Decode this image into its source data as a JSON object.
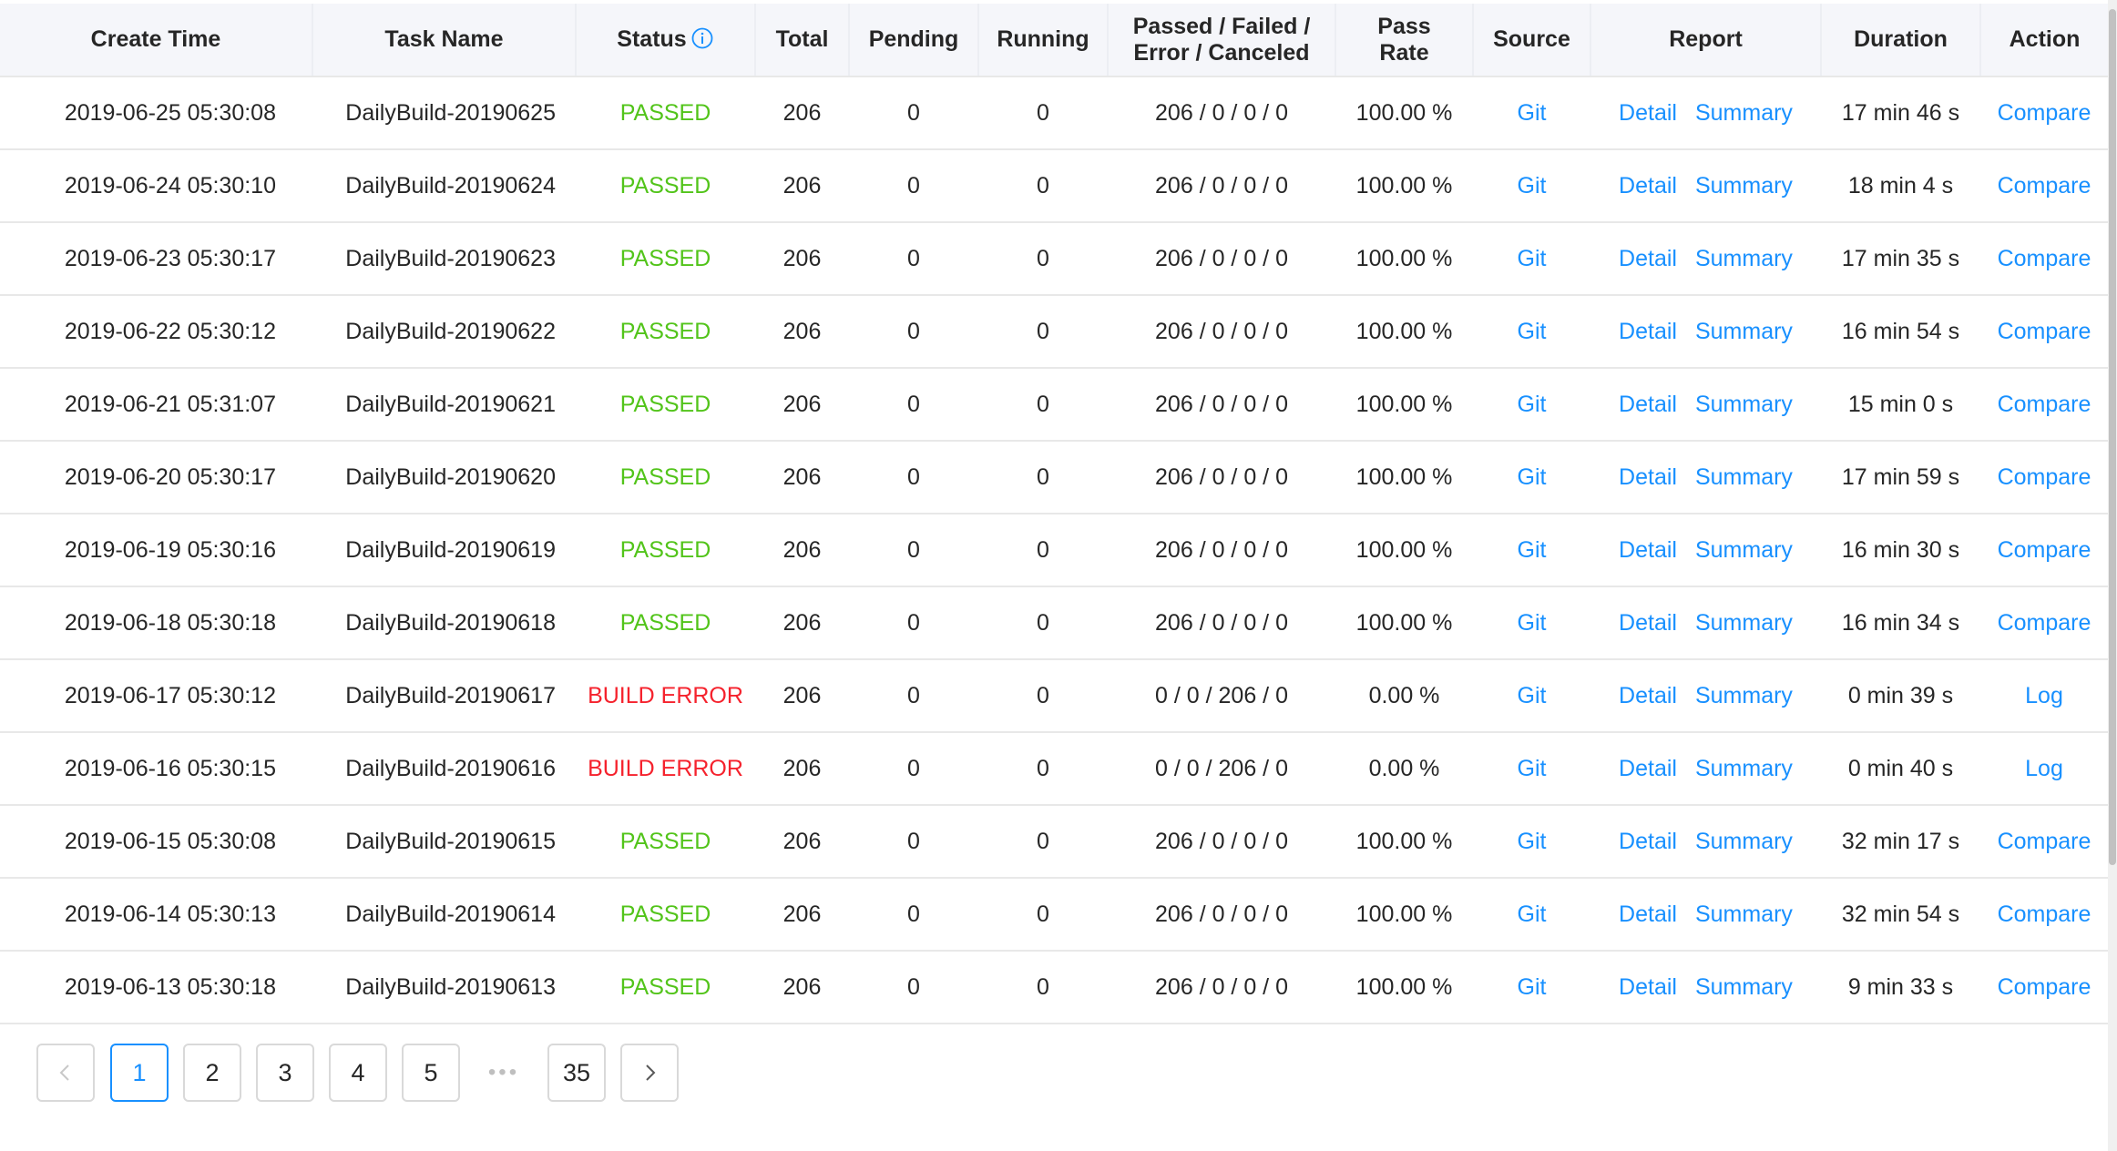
{
  "table": {
    "headers": {
      "create_time": "Create Time",
      "task_name": "Task Name",
      "status": "Status",
      "total": "Total",
      "pending": "Pending",
      "running": "Running",
      "pfec_line1": "Passed / Failed /",
      "pfec_line2": "Error / Canceled",
      "pass_rate_line1": "Pass",
      "pass_rate_line2": "Rate",
      "source": "Source",
      "report": "Report",
      "duration": "Duration",
      "action": "Action"
    },
    "status_icon": "info-circle-icon",
    "rows": [
      {
        "time": "2019-06-25 05:30:08",
        "name": "DailyBuild-20190625",
        "status": "PASSED",
        "total": "206",
        "pending": "0",
        "running": "0",
        "pfec": "206 / 0 / 0 / 0",
        "rate": "100.00 %",
        "source": "Git",
        "detail": "Detail",
        "summary": "Summary",
        "duration": "17 min 46 s",
        "action": "Compare"
      },
      {
        "time": "2019-06-24 05:30:10",
        "name": "DailyBuild-20190624",
        "status": "PASSED",
        "total": "206",
        "pending": "0",
        "running": "0",
        "pfec": "206 / 0 / 0 / 0",
        "rate": "100.00 %",
        "source": "Git",
        "detail": "Detail",
        "summary": "Summary",
        "duration": "18 min 4 s",
        "action": "Compare"
      },
      {
        "time": "2019-06-23 05:30:17",
        "name": "DailyBuild-20190623",
        "status": "PASSED",
        "total": "206",
        "pending": "0",
        "running": "0",
        "pfec": "206 / 0 / 0 / 0",
        "rate": "100.00 %",
        "source": "Git",
        "detail": "Detail",
        "summary": "Summary",
        "duration": "17 min 35 s",
        "action": "Compare"
      },
      {
        "time": "2019-06-22 05:30:12",
        "name": "DailyBuild-20190622",
        "status": "PASSED",
        "total": "206",
        "pending": "0",
        "running": "0",
        "pfec": "206 / 0 / 0 / 0",
        "rate": "100.00 %",
        "source": "Git",
        "detail": "Detail",
        "summary": "Summary",
        "duration": "16 min 54 s",
        "action": "Compare"
      },
      {
        "time": "2019-06-21 05:31:07",
        "name": "DailyBuild-20190621",
        "status": "PASSED",
        "total": "206",
        "pending": "0",
        "running": "0",
        "pfec": "206 / 0 / 0 / 0",
        "rate": "100.00 %",
        "source": "Git",
        "detail": "Detail",
        "summary": "Summary",
        "duration": "15 min 0 s",
        "action": "Compare"
      },
      {
        "time": "2019-06-20 05:30:17",
        "name": "DailyBuild-20190620",
        "status": "PASSED",
        "total": "206",
        "pending": "0",
        "running": "0",
        "pfec": "206 / 0 / 0 / 0",
        "rate": "100.00 %",
        "source": "Git",
        "detail": "Detail",
        "summary": "Summary",
        "duration": "17 min 59 s",
        "action": "Compare"
      },
      {
        "time": "2019-06-19 05:30:16",
        "name": "DailyBuild-20190619",
        "status": "PASSED",
        "total": "206",
        "pending": "0",
        "running": "0",
        "pfec": "206 / 0 / 0 / 0",
        "rate": "100.00 %",
        "source": "Git",
        "detail": "Detail",
        "summary": "Summary",
        "duration": "16 min 30 s",
        "action": "Compare"
      },
      {
        "time": "2019-06-18 05:30:18",
        "name": "DailyBuild-20190618",
        "status": "PASSED",
        "total": "206",
        "pending": "0",
        "running": "0",
        "pfec": "206 / 0 / 0 / 0",
        "rate": "100.00 %",
        "source": "Git",
        "detail": "Detail",
        "summary": "Summary",
        "duration": "16 min 34 s",
        "action": "Compare"
      },
      {
        "time": "2019-06-17 05:30:12",
        "name": "DailyBuild-20190617",
        "status": "BUILD ERROR",
        "total": "206",
        "pending": "0",
        "running": "0",
        "pfec": "0 / 0 / 206 / 0",
        "rate": "0.00 %",
        "source": "Git",
        "detail": "Detail",
        "summary": "Summary",
        "duration": "0 min 39 s",
        "action": "Log"
      },
      {
        "time": "2019-06-16 05:30:15",
        "name": "DailyBuild-20190616",
        "status": "BUILD ERROR",
        "total": "206",
        "pending": "0",
        "running": "0",
        "pfec": "0 / 0 / 206 / 0",
        "rate": "0.00 %",
        "source": "Git",
        "detail": "Detail",
        "summary": "Summary",
        "duration": "0 min 40 s",
        "action": "Log"
      },
      {
        "time": "2019-06-15 05:30:08",
        "name": "DailyBuild-20190615",
        "status": "PASSED",
        "total": "206",
        "pending": "0",
        "running": "0",
        "pfec": "206 / 0 / 0 / 0",
        "rate": "100.00 %",
        "source": "Git",
        "detail": "Detail",
        "summary": "Summary",
        "duration": "32 min 17 s",
        "action": "Compare"
      },
      {
        "time": "2019-06-14 05:30:13",
        "name": "DailyBuild-20190614",
        "status": "PASSED",
        "total": "206",
        "pending": "0",
        "running": "0",
        "pfec": "206 / 0 / 0 / 0",
        "rate": "100.00 %",
        "source": "Git",
        "detail": "Detail",
        "summary": "Summary",
        "duration": "32 min 54 s",
        "action": "Compare"
      },
      {
        "time": "2019-06-13 05:30:18",
        "name": "DailyBuild-20190613",
        "status": "PASSED",
        "total": "206",
        "pending": "0",
        "running": "0",
        "pfec": "206 / 0 / 0 / 0",
        "rate": "100.00 %",
        "source": "Git",
        "detail": "Detail",
        "summary": "Summary",
        "duration": "9 min 33 s",
        "action": "Compare"
      }
    ]
  },
  "pagination": {
    "prev_icon": "chevron-left-icon",
    "next_icon": "chevron-right-icon",
    "pages": [
      "1",
      "2",
      "3",
      "4",
      "5"
    ],
    "ellipsis": "•••",
    "last_page": "35",
    "current": "1"
  },
  "colors": {
    "passed": "#52c41a",
    "error": "#f5222d",
    "link": "#1890ff",
    "header_bg": "#f5f6fa"
  }
}
